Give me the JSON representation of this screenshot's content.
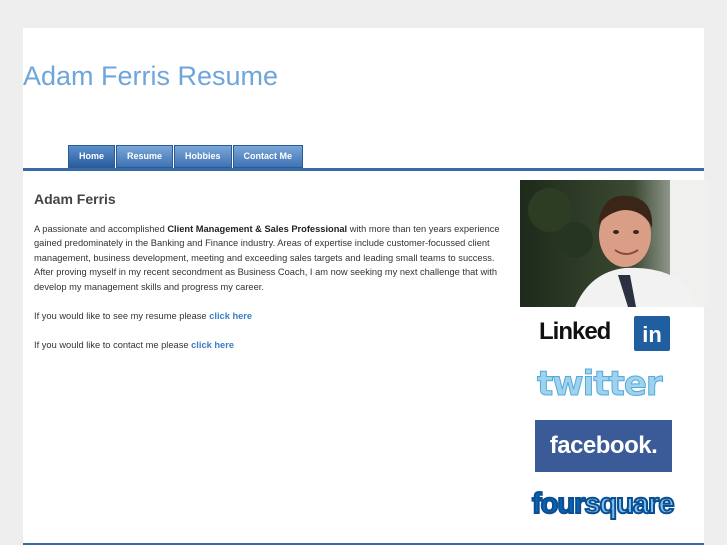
{
  "site": {
    "title": "Adam Ferris Resume"
  },
  "nav": {
    "items": [
      {
        "label": "Home"
      },
      {
        "label": "Resume"
      },
      {
        "label": "Hobbies"
      },
      {
        "label": "Contact Me"
      }
    ],
    "active": "Home"
  },
  "content": {
    "heading": "Adam Ferris",
    "intro_before": "A passionate and accomplished ",
    "intro_bold": "Client Management & Sales Professional",
    "intro_after": " with more than ten years experience gained predominately in the Banking and Finance industry. Areas of expertise include customer-focussed client management, business development, meeting and exceeding sales targets and leading small teams to success. After proving myself in my recent secondment as Business Coach, I am now seeking my next challenge that with develop my management skills and progress my career.",
    "resume_text": "If you would like to see my resume please ",
    "resume_link": "click here",
    "contact_text": "If you would like to contact me please ",
    "contact_link": "click here"
  },
  "social": {
    "linkedin_text": "Linked",
    "linkedin_box": "in",
    "twitter": "twitter",
    "facebook": "facebook.",
    "foursquare_four": "four",
    "foursquare_square": "square"
  },
  "colors": {
    "title": "#6ea6dc",
    "nav": "#3e72b3",
    "link": "#3a7cc6",
    "facebook": "#3b5a98",
    "linkedin": "#1f5f9f"
  }
}
